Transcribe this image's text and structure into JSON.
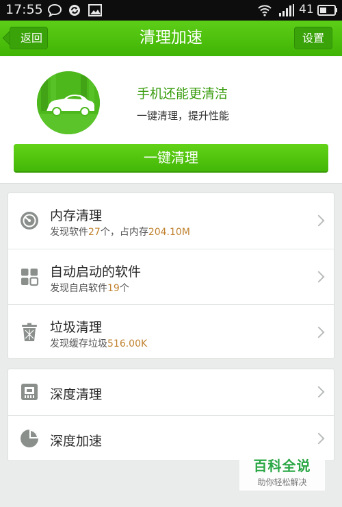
{
  "status_bar": {
    "time": "17:55",
    "battery_level": "41"
  },
  "header": {
    "back_label": "返回",
    "title": "清理加速",
    "settings_label": "设置"
  },
  "hero": {
    "title": "手机还能更清洁",
    "subtitle": "一键清理，提升性能",
    "button_label": "一键清理"
  },
  "list": {
    "memory": {
      "title": "内存清理",
      "sub_a": "发现软件",
      "apps": "27",
      "sub_b": "个，占内存",
      "size": "204.10M"
    },
    "autostart": {
      "title": "自动启动的软件",
      "sub_a": "发现自启软件",
      "count": "19",
      "sub_b": "个"
    },
    "junk": {
      "title": "垃圾清理",
      "sub_a": "发现缓存垃圾",
      "size": "516.00K"
    },
    "deep_clean": {
      "title": "深度清理"
    },
    "deep_speed": {
      "title": "深度加速"
    }
  },
  "watermark": {
    "brand": "百科全说",
    "slogan": "助你轻松解决"
  },
  "colors": {
    "accent_green": "#4cbf0c",
    "value_orange": "#c0822f"
  },
  "icons": {
    "status": [
      "chat-bubble-icon",
      "sync-icon",
      "image-icon",
      "wifi-icon",
      "signal-icon",
      "battery-icon"
    ],
    "hero": "car-icon",
    "rows": [
      "gauge-icon",
      "apps-grid-icon",
      "trash-icon",
      "chip-icon",
      "pie-chart-icon"
    ]
  }
}
